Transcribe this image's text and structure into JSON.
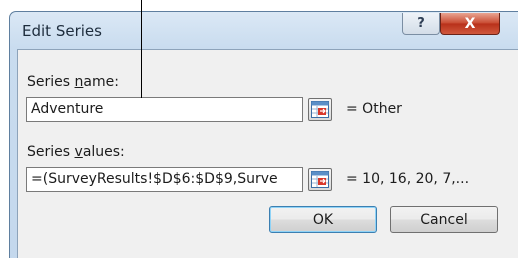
{
  "window": {
    "title": "Edit Series",
    "help_glyph": "?",
    "close_glyph": "X"
  },
  "series_name": {
    "label_prefix": "Series ",
    "label_accel": "n",
    "label_suffix": "ame:",
    "value": "Adventure",
    "result": "= Other"
  },
  "series_values": {
    "label_prefix": "Series ",
    "label_accel": "v",
    "label_suffix": "alues:",
    "value": "=(SurveyResults!$D$6:$D$9,Surve",
    "result": "= 10, 16, 20, 7,..."
  },
  "buttons": {
    "ok": "OK",
    "cancel": "Cancel"
  },
  "icons": {
    "help": "help-icon",
    "close": "close-icon",
    "range_select": "collapse-dialog-icon"
  }
}
